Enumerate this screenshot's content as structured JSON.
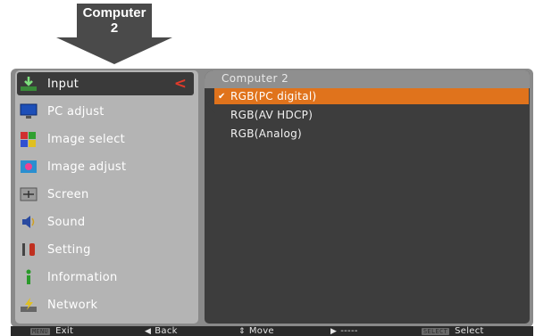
{
  "callout": {
    "line1": "Computer",
    "line2": "2"
  },
  "menu": {
    "items": [
      {
        "label": "Input",
        "icon": "input-icon",
        "selected": true
      },
      {
        "label": "PC adjust",
        "icon": "monitor-icon"
      },
      {
        "label": "Image select",
        "icon": "image-select-icon"
      },
      {
        "label": "Image adjust",
        "icon": "image-adjust-icon"
      },
      {
        "label": "Screen",
        "icon": "screen-icon"
      },
      {
        "label": "Sound",
        "icon": "speaker-icon"
      },
      {
        "label": "Setting",
        "icon": "tools-icon"
      },
      {
        "label": "Information",
        "icon": "info-icon"
      },
      {
        "label": "Network",
        "icon": "network-icon"
      }
    ]
  },
  "submenu": {
    "title": "Computer 2",
    "options": [
      {
        "label": "RGB(PC digital)",
        "checked": true,
        "highlighted": true
      },
      {
        "label": "RGB(AV HDCP)"
      },
      {
        "label": "RGB(Analog)"
      }
    ]
  },
  "bottombar": {
    "exit_key": "MENU",
    "exit_label": "Exit",
    "back_label": "Back",
    "move_label": "Move",
    "next_label": "-----",
    "select_key": "SELECT",
    "select_label": "Select"
  },
  "colors": {
    "highlight": "#e0731c",
    "chevron": "#e23a2a",
    "panel_dark": "#3d3d3d",
    "panel_light": "#b4b4b4"
  }
}
